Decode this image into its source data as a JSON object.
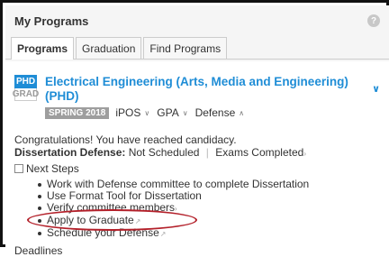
{
  "panel": {
    "title": "My Programs",
    "help_label": "?"
  },
  "tabs": [
    {
      "label": "Programs",
      "active": true
    },
    {
      "label": "Graduation",
      "active": false
    },
    {
      "label": "Find Programs",
      "active": false
    }
  ],
  "program": {
    "badge_level": "PHD",
    "badge_career": "GRAD",
    "name": "Electrical Engineering (Arts, Media and Engineering) (PHD)",
    "chevron": "∨",
    "term": "SPRING 2018",
    "meta_links": [
      {
        "label": "iPOS",
        "caret": "∨"
      },
      {
        "label": "GPA",
        "caret": "∨"
      },
      {
        "label": "Defense",
        "caret": "∧"
      }
    ]
  },
  "status": {
    "congrats": "Congratulations! You have reached candidacy.",
    "defense_label": "Dissertation Defense:",
    "defense_value": "Not Scheduled",
    "separator": "|",
    "exams_link": "Exams Completed",
    "exams_chevron": "›",
    "next_steps_label": "Next Steps"
  },
  "steps": [
    {
      "text": "Work with Defense committee to complete Dissertation",
      "suffix": ""
    },
    {
      "text": "Use Format Tool for Dissertation",
      "suffix": ""
    },
    {
      "text": "Verify committee members",
      "suffix": "›"
    },
    {
      "text": "Apply to Graduate",
      "suffix": "↗"
    },
    {
      "text": "Schedule your Defense",
      "suffix": "↗"
    }
  ],
  "deadlines_label": "Deadlines",
  "colors": {
    "accent": "#1f8dd6",
    "highlight": "#b3202a",
    "term_badge": "#9e9e9e"
  }
}
